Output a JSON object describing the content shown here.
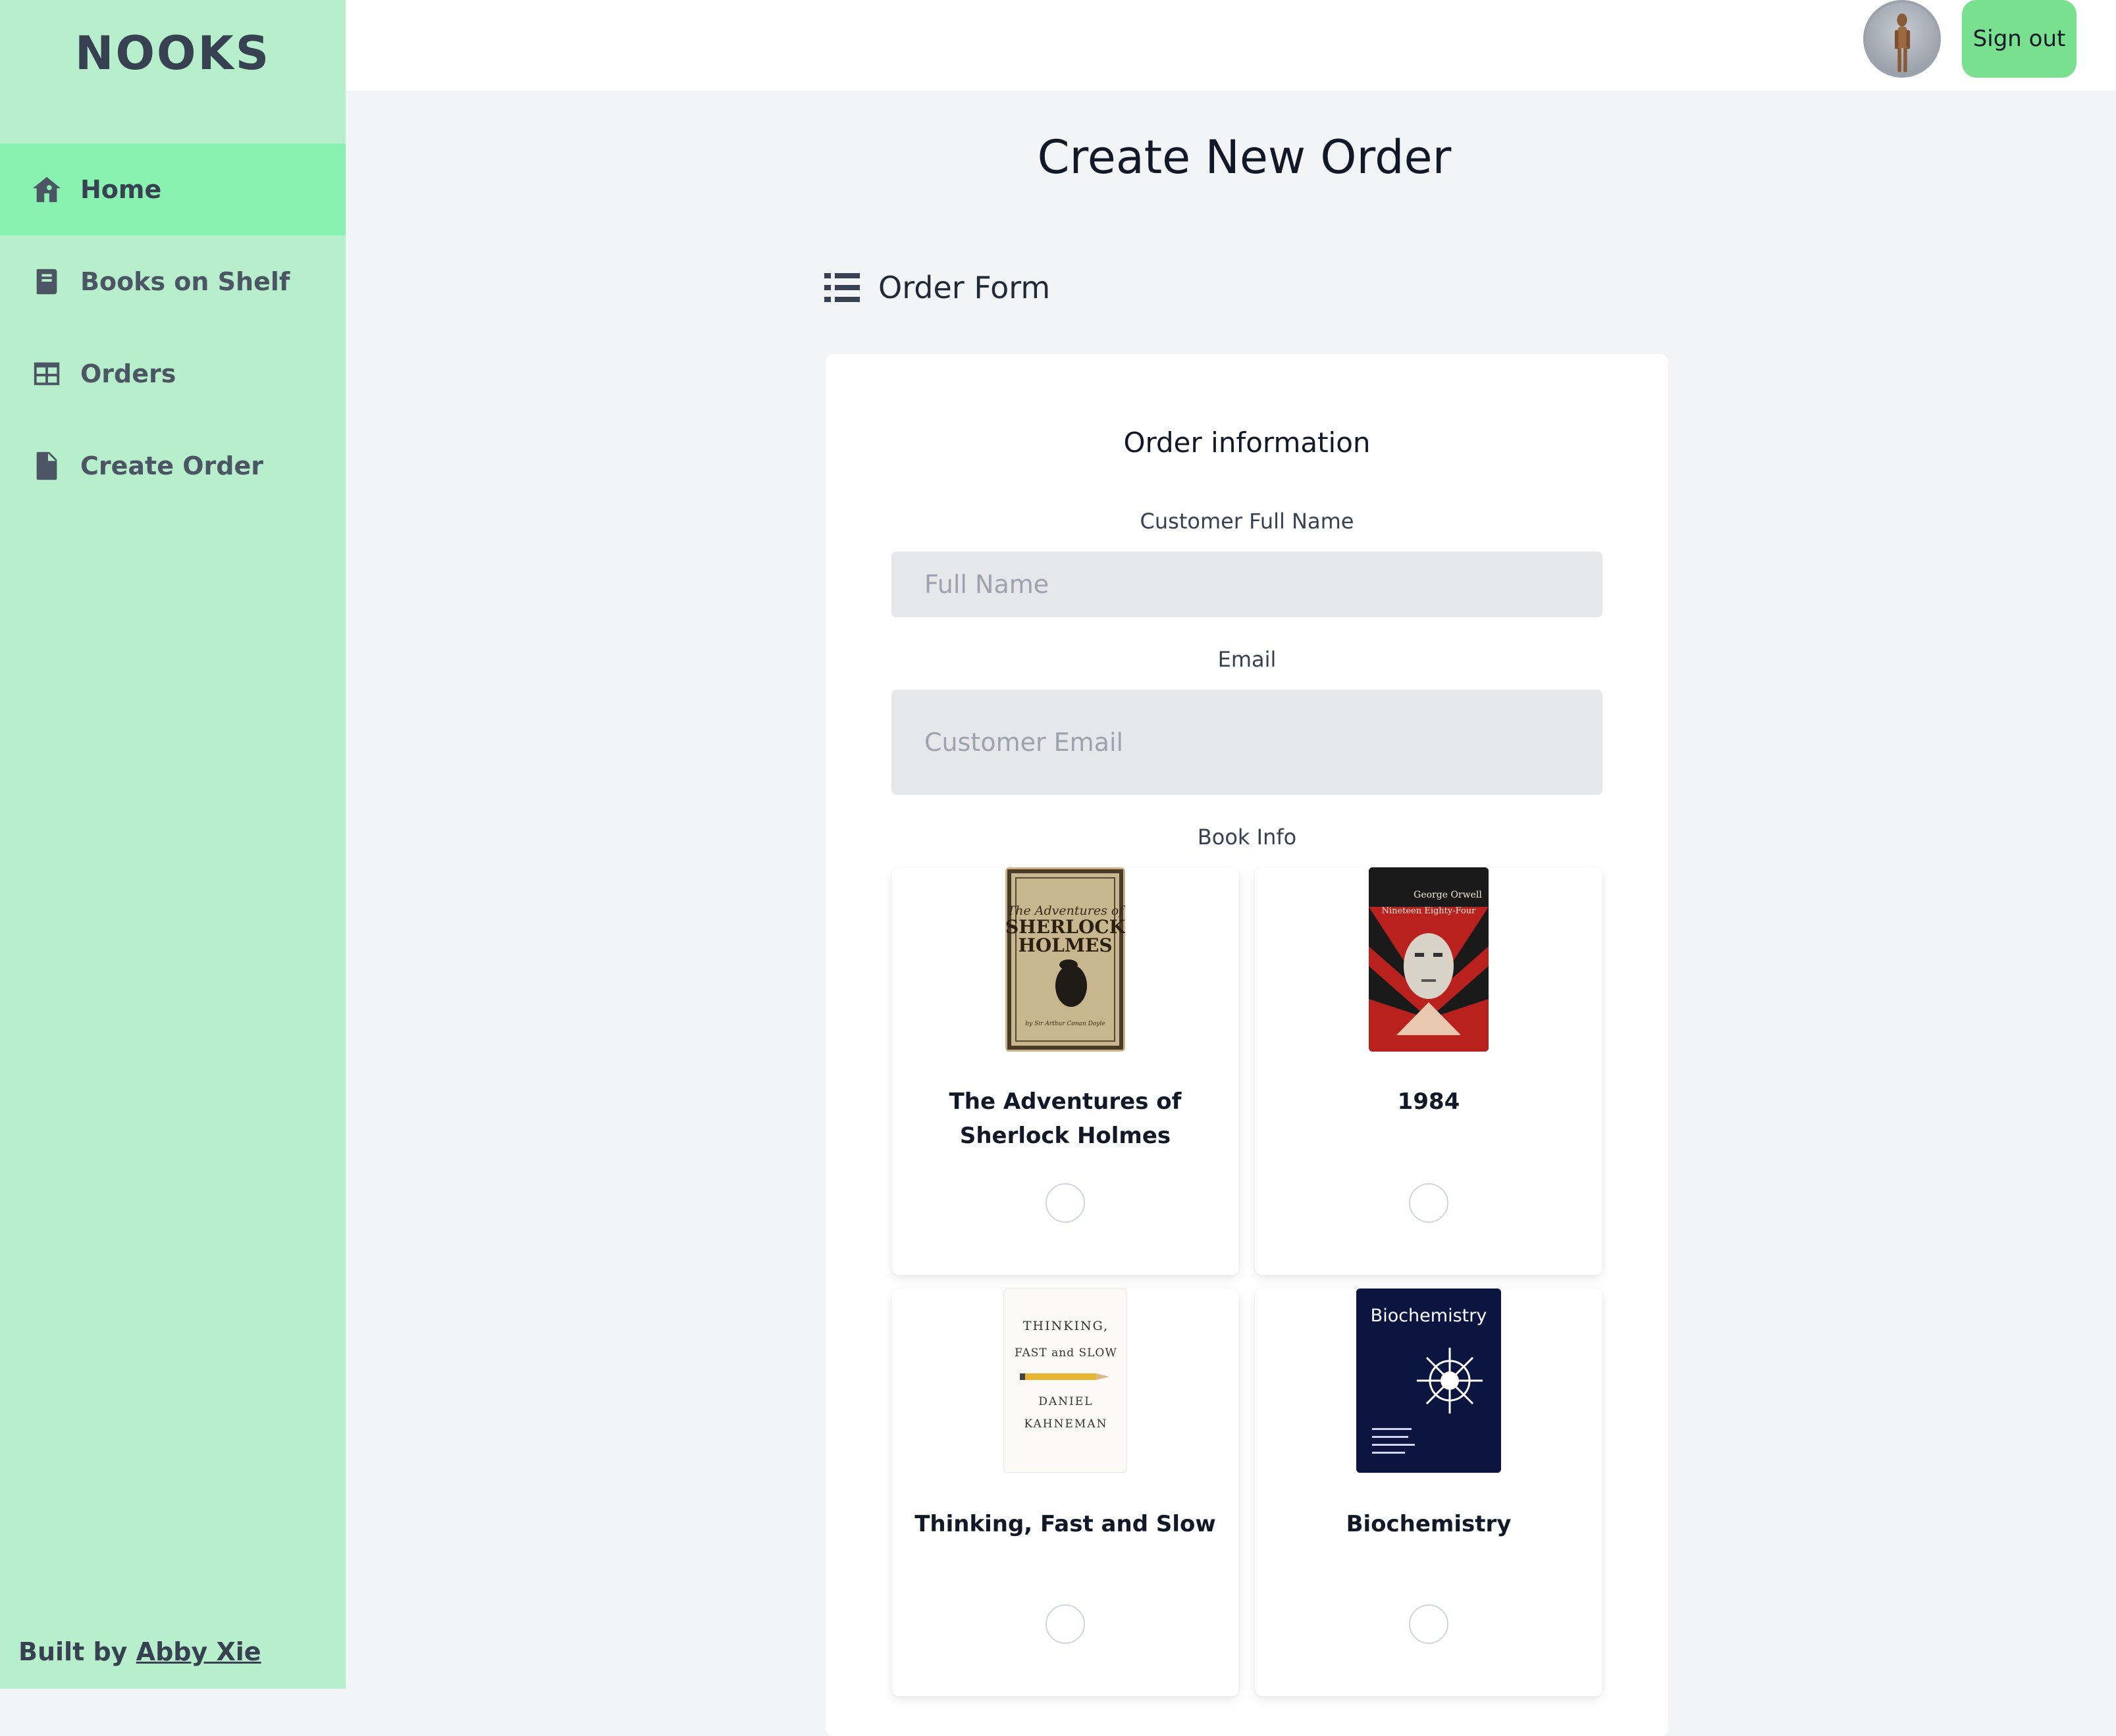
{
  "sidebar": {
    "brand": "NOOKS",
    "items": [
      {
        "label": "Home",
        "icon": "home-icon",
        "active": true
      },
      {
        "label": "Books on Shelf",
        "icon": "book-icon",
        "active": false
      },
      {
        "label": "Orders",
        "icon": "table-icon",
        "active": false
      },
      {
        "label": "Create Order",
        "icon": "document-icon",
        "active": false
      }
    ],
    "footer_prefix": "Built by ",
    "footer_link": "Abby Xie"
  },
  "header": {
    "avatar_icon": "mannequin-avatar-icon",
    "signout_label": "Sign out"
  },
  "main": {
    "title": "Create New Order",
    "section_title": "Order Form",
    "section_icon": "list-icon",
    "form": {
      "heading": "Order information",
      "name_label": "Customer Full Name",
      "name_placeholder": "Full Name",
      "email_label": "Email",
      "email_placeholder": "Customer Email",
      "book_label": "Book Info",
      "books": [
        {
          "title": "The Adventures of Sherlock Holmes",
          "cover_text": [
            "The Adventures of",
            "SHERLOCK",
            "HOLMES",
            "by Sir Arthur Conan Doyle"
          ]
        },
        {
          "title": "1984",
          "cover_text": [
            "George Orwell",
            "Nineteen Eighty-Four"
          ]
        },
        {
          "title": "Thinking, Fast and Slow",
          "cover_text": [
            "THINKING,",
            "FAST and SLOW",
            "DANIEL",
            "KAHNEMAN"
          ]
        },
        {
          "title": "Biochemistry",
          "cover_text": [
            "Biochemistry"
          ]
        }
      ]
    }
  },
  "colors": {
    "sidebar_bg": "#b7eecb",
    "active_nav": "#8af2b0",
    "signout_bg": "#79e08f",
    "page_bg": "#f3f4f6"
  }
}
